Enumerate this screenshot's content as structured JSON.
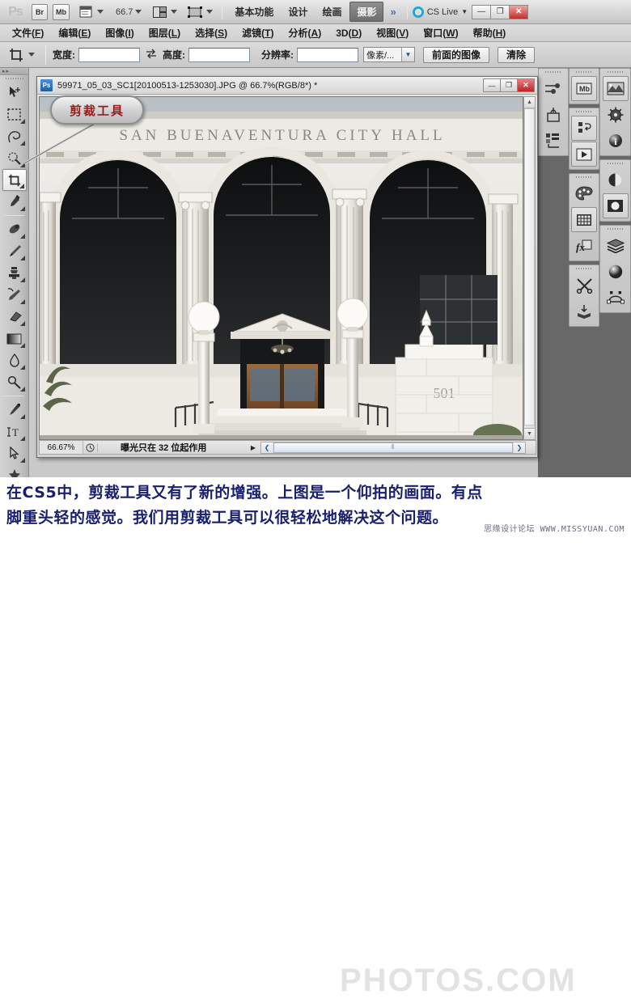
{
  "appbar": {
    "logo": "Ps",
    "buttons": [
      {
        "name": "bridge-button",
        "label": "Br"
      },
      {
        "name": "mini-bridge-button",
        "label": "Mb"
      }
    ],
    "view_extras_icon": "view-extras-icon",
    "zoom_level": "66.7",
    "arrange_icon": "arrange-documents-icon",
    "screen_mode_icon": "screen-mode-icon",
    "workspaces": [
      {
        "label": "基本功能",
        "active": false
      },
      {
        "label": "设计",
        "active": false
      },
      {
        "label": "绘画",
        "active": false
      },
      {
        "label": "摄影",
        "active": true
      }
    ],
    "more_label": "»",
    "cs_live_label": "CS Live",
    "cs_live_caret": "▼",
    "window_buttons": [
      {
        "name": "app-minimize-button",
        "label": "—"
      },
      {
        "name": "app-restore-button",
        "label": "❐"
      },
      {
        "name": "app-close-button",
        "label": "✕"
      }
    ]
  },
  "menubar": {
    "items": [
      {
        "label": "文件",
        "key": "F"
      },
      {
        "label": "编辑",
        "key": "E"
      },
      {
        "label": "图像",
        "key": "I"
      },
      {
        "label": "图层",
        "key": "L"
      },
      {
        "label": "选择",
        "key": "S"
      },
      {
        "label": "滤镜",
        "key": "T"
      },
      {
        "label": "分析",
        "key": "A"
      },
      {
        "label": "3D",
        "key": "D"
      },
      {
        "label": "视图",
        "key": "V"
      },
      {
        "label": "窗口",
        "key": "W"
      },
      {
        "label": "帮助",
        "key": "H"
      }
    ]
  },
  "optionsbar": {
    "tool_icon": "crop-tool-icon",
    "tool_preset_caret": "▼",
    "width_label": "宽度:",
    "width_value": "",
    "swap_icon": "swap-width-height-icon",
    "height_label": "高度:",
    "height_value": "",
    "resolution_label": "分辨率:",
    "resolution_value": "",
    "unit_value": "像素/...",
    "unit_caret": "▼",
    "front_image_button": "前面的图像",
    "clear_button": "清除"
  },
  "toolbar": {
    "tools": [
      {
        "name": "move-tool",
        "icon": "move-tool-icon",
        "selected": false,
        "group_end": false
      },
      {
        "name": "marquee-tool",
        "icon": "rectangular-marquee-icon",
        "selected": false,
        "group_end": false
      },
      {
        "name": "lasso-tool",
        "icon": "lasso-tool-icon",
        "selected": false,
        "group_end": false
      },
      {
        "name": "quick-selection-tool",
        "icon": "quick-selection-icon",
        "selected": false,
        "group_end": false
      },
      {
        "name": "crop-tool",
        "icon": "crop-tool-icon",
        "selected": true,
        "group_end": false
      },
      {
        "name": "eyedropper-tool",
        "icon": "eyedropper-icon",
        "selected": false,
        "group_end": true
      },
      {
        "name": "spot-healing-tool",
        "icon": "spot-healing-icon",
        "selected": false,
        "group_end": false
      },
      {
        "name": "brush-tool",
        "icon": "brush-icon",
        "selected": false,
        "group_end": false
      },
      {
        "name": "clone-stamp-tool",
        "icon": "clone-stamp-icon",
        "selected": false,
        "group_end": false
      },
      {
        "name": "history-brush-tool",
        "icon": "history-brush-icon",
        "selected": false,
        "group_end": false
      },
      {
        "name": "eraser-tool",
        "icon": "eraser-icon",
        "selected": false,
        "group_end": false
      },
      {
        "name": "gradient-tool",
        "icon": "gradient-icon",
        "selected": false,
        "group_end": false
      },
      {
        "name": "blur-tool",
        "icon": "blur-drop-icon",
        "selected": false,
        "group_end": false
      },
      {
        "name": "dodge-tool",
        "icon": "dodge-icon",
        "selected": false,
        "group_end": true
      },
      {
        "name": "pen-tool",
        "icon": "pen-icon",
        "selected": false,
        "group_end": false
      },
      {
        "name": "type-tool",
        "icon": "type-tool-icon",
        "selected": false,
        "group_end": false
      },
      {
        "name": "path-selection-tool",
        "icon": "path-selection-icon",
        "selected": false,
        "group_end": false
      },
      {
        "name": "shape-tool",
        "icon": "custom-shape-icon",
        "selected": false,
        "group_end": true
      },
      {
        "name": "hand-tool",
        "icon": "hand-tool-icon",
        "selected": false,
        "group_end": false
      },
      {
        "name": "zoom-tool",
        "icon": "zoom-tool-icon",
        "selected": false,
        "group_end": false
      }
    ]
  },
  "rightdock": {
    "column1": [
      {
        "name": "panel-adjustments-icon",
        "icon": "adjustments-icon"
      },
      {
        "name": "panel-masks-icon",
        "icon": "masks-icon"
      },
      {
        "name": "panel-channels-icon",
        "icon": "channels-icon"
      }
    ],
    "column2": [
      {
        "name": "panel-mini-bridge-icon",
        "icon": "mini-bridge-icon",
        "framed": true
      },
      {
        "name": "panel-actions-icon",
        "icon": "actions-icon",
        "framed": true
      },
      {
        "name": "panel-animation-icon",
        "icon": "animation-play-icon",
        "framed": true
      },
      {
        "name": "panel-color-icon",
        "icon": "color-palette-icon",
        "framed": false
      },
      {
        "name": "panel-swatches-icon",
        "icon": "swatches-grid-icon",
        "framed": true
      },
      {
        "name": "panel-styles-icon",
        "icon": "styles-fx-icon",
        "framed": false
      },
      {
        "name": "panel-tools-icon",
        "icon": "tools-scissors-icon",
        "framed": false
      },
      {
        "name": "panel-notes-icon",
        "icon": "notes-icon",
        "framed": false
      }
    ],
    "column3": [
      {
        "name": "panel-histogram-icon",
        "icon": "histogram-image-icon",
        "framed": true
      },
      {
        "name": "panel-navigator-icon",
        "icon": "navigator-compass-icon",
        "framed": false
      },
      {
        "name": "panel-info-icon",
        "icon": "info-icon",
        "framed": false
      },
      {
        "name": "panel-adjustment-layer-icon",
        "icon": "half-circle-icon",
        "framed": false
      },
      {
        "name": "panel-mask-icon",
        "icon": "mask-circle-icon",
        "framed": true
      },
      {
        "name": "panel-layers-icon",
        "icon": "layers-stack-icon",
        "framed": false
      },
      {
        "name": "panel-3d-icon",
        "icon": "sphere-3d-icon",
        "framed": false
      },
      {
        "name": "panel-paths-icon",
        "icon": "paths-icon",
        "framed": false
      }
    ]
  },
  "document": {
    "icon": "photoshop-document-icon",
    "title": "59971_05_03_SC1[20100513-1253030].JPG @ 66.7%(RGB/8*) *",
    "window_buttons": [
      {
        "name": "doc-minimize-button",
        "label": "—"
      },
      {
        "name": "doc-restore-button",
        "label": "❐"
      },
      {
        "name": "doc-close-button",
        "label": "✕"
      }
    ],
    "status": {
      "zoom": "66.67%",
      "clock_icon": "clock-icon",
      "message": "曝光只在 32 位起作用",
      "expand_arrow": "▶",
      "scroll_left": "❮",
      "scroll_right": "❯",
      "scroll_grip": "⦀"
    },
    "vscroll": {
      "up_arrow": "▲",
      "down_arrow": "▼"
    }
  },
  "callout": {
    "label": "剪裁工具"
  },
  "image_content": {
    "building_name": "SAN BUENAVENTURA CITY HALL",
    "street_number": "501"
  },
  "caption": {
    "line1": "在CS5中，剪裁工具又有了新的增强。上图是一个仰拍的画面。有点",
    "line2": "脚重头轻的感觉。我们用剪裁工具可以很轻松地解决这个问题。"
  },
  "watermark": {
    "big": "PHOTOS.COM",
    "small": "思缘设计论坛 WWW.MISSYUAN.COM"
  },
  "colors": {
    "accent": "#1ea7d8",
    "close": "#b92525",
    "caption_text": "#171f6e",
    "callout_text": "#9b1b1b",
    "chrome": "#c9c9c9"
  }
}
